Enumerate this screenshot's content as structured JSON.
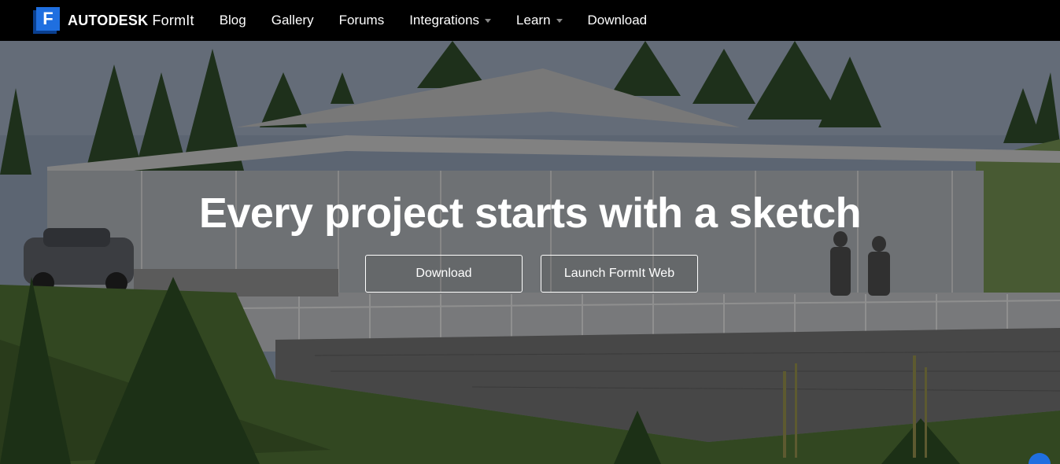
{
  "brand": {
    "logo_letter": "F",
    "name_bold": "AUTODESK",
    "name_product": "FormIt"
  },
  "nav": {
    "items": [
      {
        "label": "Blog",
        "dropdown": false
      },
      {
        "label": "Gallery",
        "dropdown": false
      },
      {
        "label": "Forums",
        "dropdown": false
      },
      {
        "label": "Integrations",
        "dropdown": true
      },
      {
        "label": "Learn",
        "dropdown": true
      },
      {
        "label": "Download",
        "dropdown": false
      }
    ]
  },
  "hero": {
    "title": "Every project starts with a sketch",
    "primary_button": "Download",
    "secondary_button": "Launch FormIt Web"
  },
  "colors": {
    "navbar_bg": "#000000",
    "brand_blue": "#1f6fe0",
    "text": "#ffffff"
  },
  "icons": {
    "logo": "formit-logo-icon",
    "dropdown": "caret-down-icon",
    "help": "help-chat-icon"
  }
}
